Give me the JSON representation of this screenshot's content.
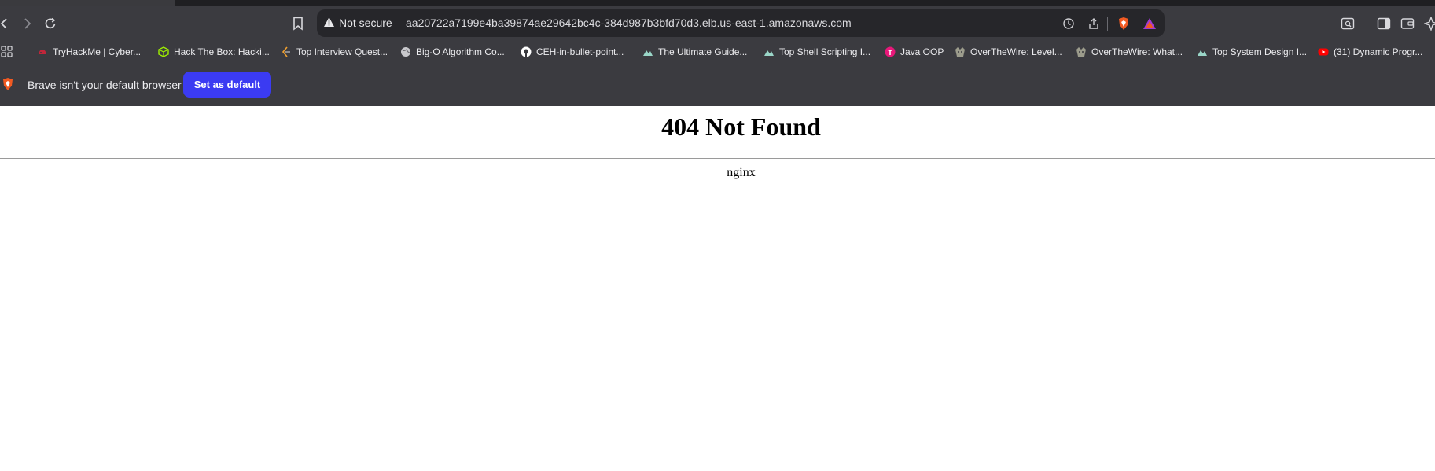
{
  "browser": {
    "address_bar": {
      "security_label": "Not secure",
      "url": "aa20722a7199e4ba39874ae29642bc4c-384d987b3bfd70d3.elb.us-east-1.amazonaws.com"
    },
    "bookmarks": [
      {
        "label": "TryHackMe | Cyber...",
        "icon": "tryhackme-icon",
        "color": "#c0263a"
      },
      {
        "label": "Hack The Box: Hacki...",
        "icon": "hackthebox-icon",
        "color": "#9fef00"
      },
      {
        "label": "Top Interview Quest...",
        "icon": "leetcode-icon",
        "color": "#f0a030"
      },
      {
        "label": "Big-O Algorithm Co...",
        "icon": "globe-icon",
        "color": "#c8c8cc"
      },
      {
        "label": "CEH-in-bullet-point...",
        "icon": "github-icon",
        "color": "#ffffff"
      },
      {
        "label": "The Ultimate Guide...",
        "icon": "mountain-icon",
        "color": "#9ad6c8"
      },
      {
        "label": "Top Shell Scripting I...",
        "icon": "mountain-icon",
        "color": "#9ad6c8"
      },
      {
        "label": "Java OOP",
        "icon": "t-logo-icon",
        "color": "#e8187a"
      },
      {
        "label": "OverTheWire: Level...",
        "icon": "otw-icon",
        "color": "#9c9c8c"
      },
      {
        "label": "OverTheWire: What...",
        "icon": "otw-icon",
        "color": "#9c9c8c"
      },
      {
        "label": "Top System Design I...",
        "icon": "mountain-icon",
        "color": "#9ad6c8"
      },
      {
        "label": "(31) Dynamic Progr...",
        "icon": "youtube-icon",
        "color": "#ff0000"
      }
    ],
    "infobar": {
      "message": "Brave isn't your default browser",
      "button_label": "Set as default"
    },
    "accent": "#3b3bf2"
  },
  "page": {
    "heading": "404 Not Found",
    "server": "nginx"
  }
}
